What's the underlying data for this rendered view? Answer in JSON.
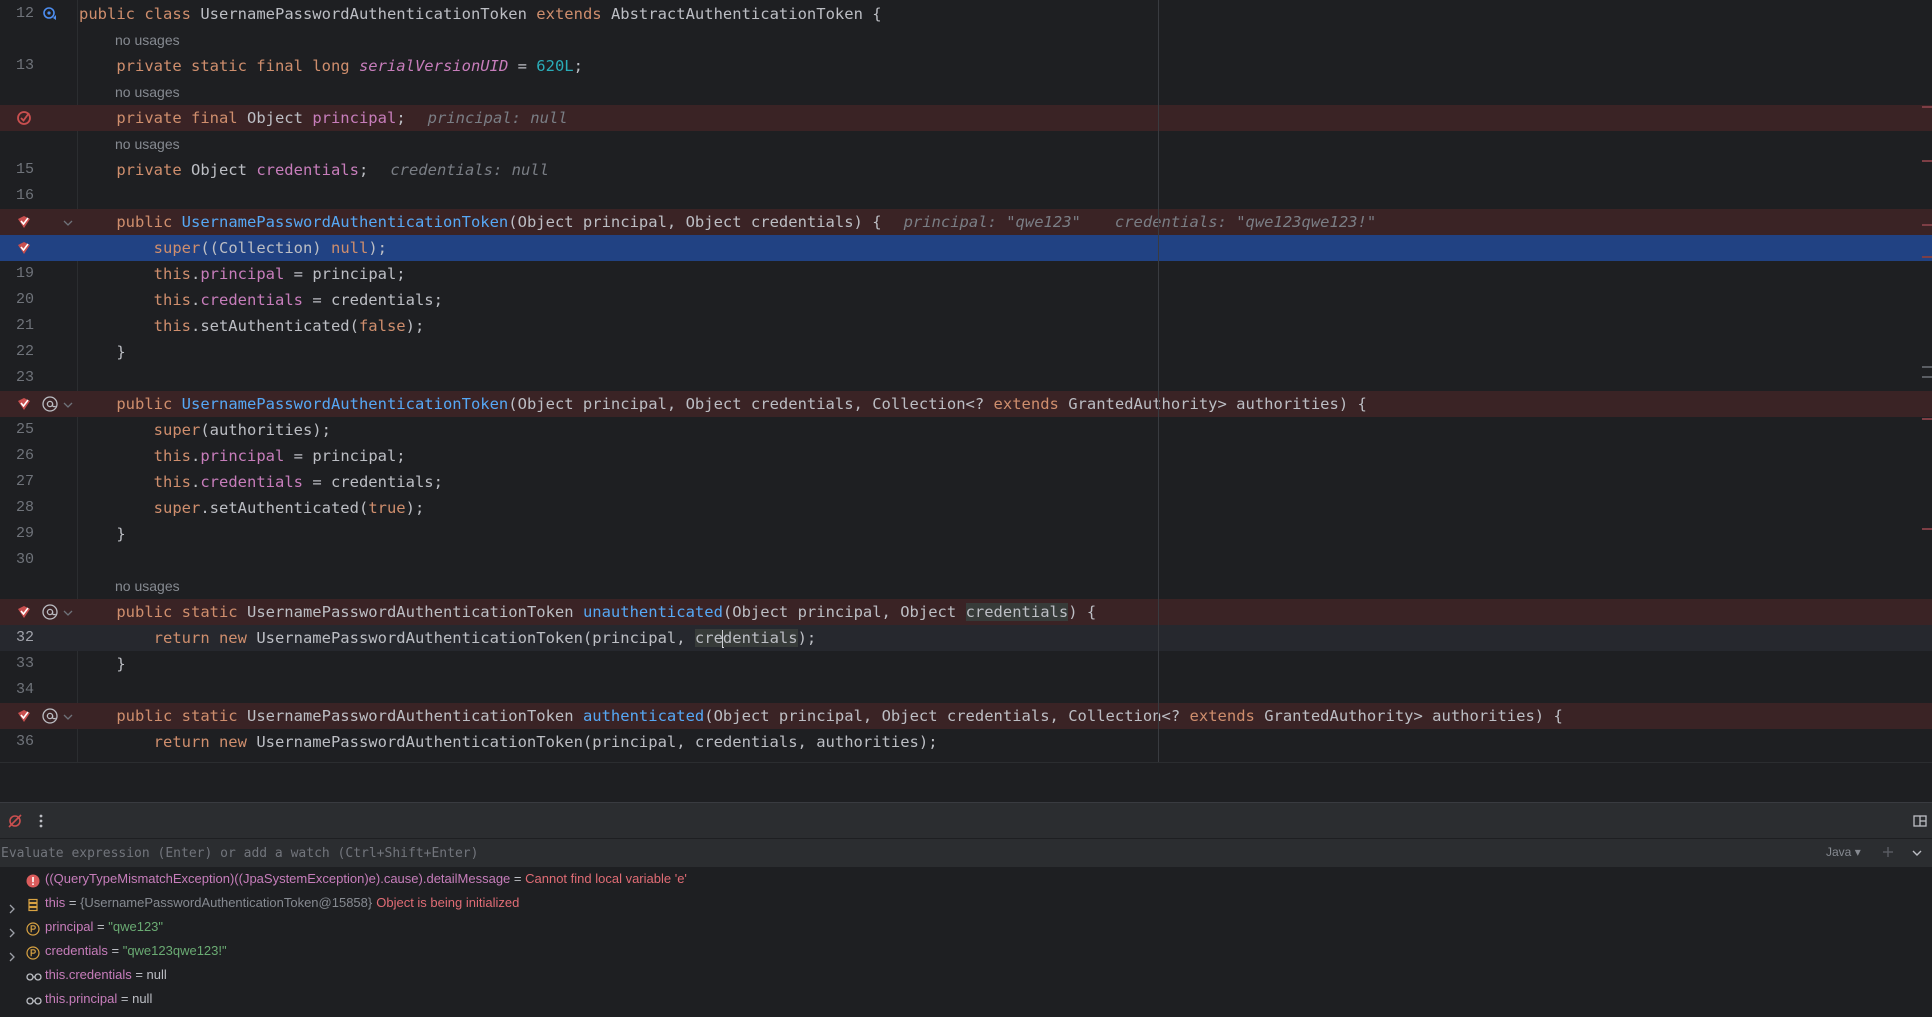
{
  "editor": {
    "lines": [
      {
        "ln": "12",
        "code_tokens": [
          [
            "public class ",
            "kw"
          ],
          [
            "UsernamePasswordAuthenticationToken ",
            ""
          ],
          [
            "extends ",
            "kw"
          ],
          [
            "AbstractAuthenticationToken {",
            ""
          ]
        ]
      },
      {
        "usage": "no usages"
      },
      {
        "ln": "13",
        "code_tokens": [
          [
            "    private static final long ",
            "kw"
          ],
          [
            "serialVersionUID",
            "fld ital"
          ],
          [
            " = ",
            ""
          ],
          [
            "620L",
            "num"
          ],
          [
            ";",
            ""
          ]
        ]
      },
      {
        "usage": "no usages"
      },
      {
        "ln": "",
        "breakpoint": true,
        "code_tokens": [
          [
            "    private final ",
            "kw"
          ],
          [
            "Object ",
            ""
          ],
          [
            "principal",
            "fld"
          ],
          [
            ";",
            ""
          ]
        ],
        "hints": [
          "principal: null"
        ]
      },
      {
        "usage": "no usages"
      },
      {
        "ln": "15",
        "code_tokens": [
          [
            "    private ",
            "kw"
          ],
          [
            "Object ",
            ""
          ],
          [
            "credentials",
            "fld"
          ],
          [
            ";",
            ""
          ]
        ],
        "hints": [
          "credentials: null"
        ]
      },
      {
        "ln": "16"
      },
      {
        "ln": "",
        "breakpoint": true,
        "code_tokens": [
          [
            "    public ",
            "kw"
          ],
          [
            "UsernamePasswordAuthenticationToken",
            "fn"
          ],
          [
            "(Object principal, Object credentials) {",
            ""
          ]
        ],
        "hints": [
          "principal: \"qwe123\"",
          "credentials: \"qwe123qwe123!\""
        ]
      },
      {
        "ln": "",
        "current": true,
        "code_tokens": [
          [
            "        super",
            "kw"
          ],
          [
            "((Collection) ",
            ""
          ],
          [
            "null",
            "kw"
          ],
          [
            ");",
            ""
          ]
        ]
      },
      {
        "ln": "19",
        "code_tokens": [
          [
            "        this",
            "kw"
          ],
          [
            ".",
            ""
          ],
          [
            "principal",
            "fld"
          ],
          [
            " = principal;",
            ""
          ]
        ]
      },
      {
        "ln": "20",
        "code_tokens": [
          [
            "        this",
            "kw"
          ],
          [
            ".",
            ""
          ],
          [
            "credentials",
            "fld"
          ],
          [
            " = credentials;",
            ""
          ]
        ]
      },
      {
        "ln": "21",
        "code_tokens": [
          [
            "        this",
            "kw"
          ],
          [
            ".setAuthenticated(",
            ""
          ],
          [
            "false",
            "kw"
          ],
          [
            ");",
            ""
          ]
        ]
      },
      {
        "ln": "22",
        "code_tokens": [
          [
            "    }",
            ""
          ]
        ]
      },
      {
        "ln": "23"
      },
      {
        "ln": "",
        "breakpoint": true,
        "code_tokens": [
          [
            "    public ",
            "kw"
          ],
          [
            "UsernamePasswordAuthenticationToken",
            "fn"
          ],
          [
            "(Object principal, Object credentials, Collection<? ",
            ""
          ],
          [
            "extends ",
            "kw"
          ],
          [
            "GrantedAuthority> authorities) {",
            ""
          ]
        ]
      },
      {
        "ln": "25",
        "code_tokens": [
          [
            "        super",
            "kw"
          ],
          [
            "(authorities);",
            ""
          ]
        ]
      },
      {
        "ln": "26",
        "code_tokens": [
          [
            "        this",
            "kw"
          ],
          [
            ".",
            ""
          ],
          [
            "principal",
            "fld"
          ],
          [
            " = principal;",
            ""
          ]
        ]
      },
      {
        "ln": "27",
        "code_tokens": [
          [
            "        this",
            "kw"
          ],
          [
            ".",
            ""
          ],
          [
            "credentials",
            "fld"
          ],
          [
            " = credentials;",
            ""
          ]
        ]
      },
      {
        "ln": "28",
        "code_tokens": [
          [
            "        super",
            "kw"
          ],
          [
            ".setAuthenticated(",
            ""
          ],
          [
            "true",
            "kw"
          ],
          [
            ");",
            ""
          ]
        ]
      },
      {
        "ln": "29",
        "code_tokens": [
          [
            "    }",
            ""
          ]
        ]
      },
      {
        "ln": "30"
      },
      {
        "usage": "no usages"
      },
      {
        "ln": "",
        "breakpoint": true,
        "code_tokens": [
          [
            "    public static ",
            "kw"
          ],
          [
            "UsernamePasswordAuthenticationToken ",
            ""
          ],
          [
            "unauthenticated",
            "fn"
          ],
          [
            "(Object principal, Object ",
            ""
          ],
          [
            "credentials",
            "hl"
          ],
          [
            ") {",
            ""
          ]
        ]
      },
      {
        "ln": "32",
        "caret": true,
        "code_tokens": [
          [
            "        return new ",
            "kw"
          ],
          [
            "UsernamePasswordAuthenticationToken(principal, ",
            ""
          ],
          [
            "cre",
            "hl"
          ],
          [
            "|",
            "caret"
          ],
          [
            "dentials",
            "hl"
          ],
          [
            ");",
            ""
          ]
        ]
      },
      {
        "ln": "33",
        "code_tokens": [
          [
            "    }",
            ""
          ]
        ]
      },
      {
        "ln": "34"
      },
      {
        "ln": "",
        "breakpoint": true,
        "code_tokens": [
          [
            "    public static ",
            "kw"
          ],
          [
            "UsernamePasswordAuthenticationToken ",
            ""
          ],
          [
            "authenticated",
            "fn"
          ],
          [
            "(Object principal, Object credentials, Collection<? ",
            ""
          ],
          [
            "extends ",
            "kw"
          ],
          [
            "GrantedAuthority> authorities) {",
            ""
          ]
        ]
      },
      {
        "ln": "36",
        "code_tokens": [
          [
            "        return new ",
            "kw"
          ],
          [
            "UsernamePasswordAuthenticationToken(principal, credentials, authorities);",
            ""
          ]
        ]
      }
    ]
  },
  "evaluate": {
    "placeholder": "Evaluate expression (Enter) or add a watch (Ctrl+Shift+Enter)",
    "language": "Java"
  },
  "variables": [
    {
      "kind": "error",
      "name": "((QueryTypeMismatchException)((JpaSystemException)e).cause).detailMessage",
      "eq": " = ",
      "value": "Cannot find local variable 'e'",
      "value_class": "verr"
    },
    {
      "kind": "this",
      "expandable": true,
      "name": "this",
      "eq": " = ",
      "type": "{UsernamePasswordAuthenticationToken@15858}",
      "value": "Object is being initialized",
      "value_class": "verr"
    },
    {
      "kind": "param",
      "expandable": true,
      "name": "principal",
      "eq": " = ",
      "value": "\"qwe123\"",
      "value_class": "vstr"
    },
    {
      "kind": "param",
      "expandable": true,
      "name": "credentials",
      "eq": " = ",
      "value": "\"qwe123qwe123!\"",
      "value_class": "vstr"
    },
    {
      "kind": "watch",
      "name": "this.credentials",
      "eq": " = ",
      "value": "null",
      "value_class": "vnull"
    },
    {
      "kind": "watch",
      "name": "this.principal",
      "eq": " = ",
      "value": "null",
      "value_class": "vnull"
    }
  ],
  "colors": {
    "breakpoint_line": "#3a2325",
    "current_line": "#214283",
    "keyword": "#cf8e6d",
    "method": "#56a8f5",
    "field": "#c77dbb",
    "number": "#2aacb8",
    "string": "#6aab73",
    "error": "#e06c75"
  },
  "icons": {
    "toolbar": [
      "mute-breakpoints-icon",
      "more-options-icon",
      "layout-icon"
    ],
    "gutter": [
      "breakpoint-icon",
      "annotation-at-icon",
      "override-icon",
      "fold-chevron-icon"
    ]
  }
}
